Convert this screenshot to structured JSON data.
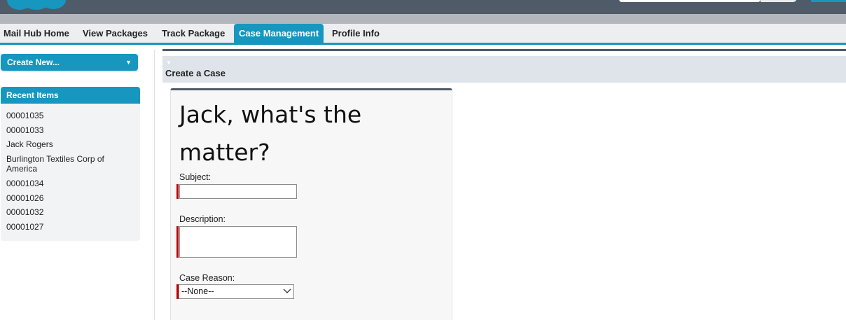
{
  "tabs": [
    {
      "label": "Mail Hub Home",
      "active": false
    },
    {
      "label": "View Packages",
      "active": false
    },
    {
      "label": "Track Package",
      "active": false
    },
    {
      "label": "Case Management",
      "active": true
    },
    {
      "label": "Profile Info",
      "active": false
    }
  ],
  "sidebar": {
    "create_new_label": "Create New...",
    "recent_items_title": "Recent Items",
    "recent_items": [
      "00001035",
      "00001033",
      "Jack Rogers",
      "Burlington Textiles Corp of America",
      "00001034",
      "00001026",
      "00001032",
      "00001027"
    ]
  },
  "main": {
    "section_title": "Create a Case",
    "greeting": "Jack, what's the matter?",
    "form": {
      "subject_label": "Subject:",
      "subject_value": "",
      "description_label": "Description:",
      "description_value": "",
      "case_reason_label": "Case Reason:",
      "case_reason_selected": "--None--"
    }
  },
  "colors": {
    "accent": "#1797c0",
    "header": "#4f5b69",
    "required": "#c00000"
  },
  "icons": {
    "logo": "salesforce-cloud-logo",
    "create_caret": "caret-down-icon",
    "section_toggle": "triangle-down-icon",
    "select_chevron": "chevron-down-icon"
  }
}
